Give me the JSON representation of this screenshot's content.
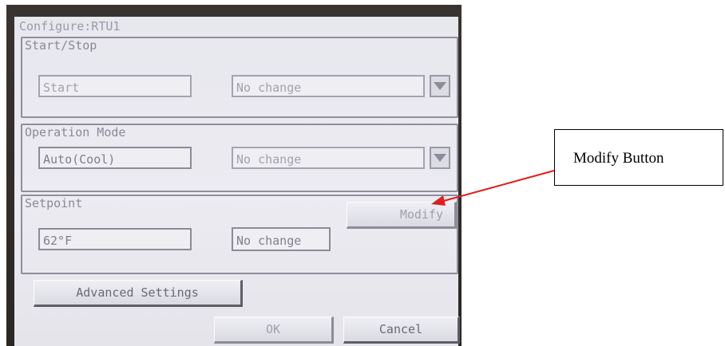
{
  "window": {
    "title": "Configure:RTU1"
  },
  "start_stop": {
    "label": "Start/Stop",
    "current": "Start",
    "select_value": "No change"
  },
  "operation_mode": {
    "label": "Operation Mode",
    "current": "Auto(Cool)",
    "select_value": "No change"
  },
  "setpoint": {
    "label": "Setpoint",
    "current": "62°F",
    "new_value": "No change",
    "modify_label": "Modify"
  },
  "buttons": {
    "advanced": "Advanced Settings",
    "ok": "OK",
    "cancel": "Cancel"
  },
  "annotation": {
    "text": "Modify Button",
    "arrow_color": "#e0201c"
  },
  "icons": [
    "dropdown-arrow-icon"
  ]
}
